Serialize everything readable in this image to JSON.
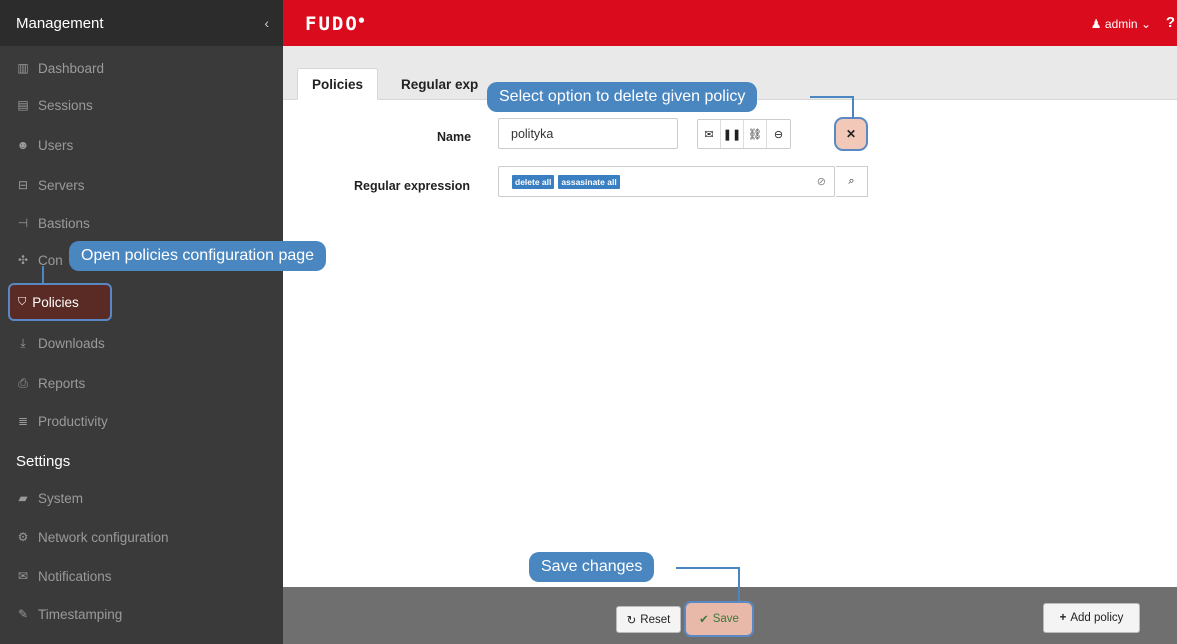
{
  "sidebar": {
    "header": "Management",
    "collapse_icon": "‹",
    "items": [
      {
        "label": "Dashboard",
        "icon": "dashboard-icon"
      },
      {
        "label": "Sessions",
        "icon": "film-icon"
      },
      {
        "label": "Users",
        "icon": "users-icon"
      },
      {
        "label": "Servers",
        "icon": "server-icon"
      },
      {
        "label": "Bastions",
        "icon": "sitemap-icon"
      },
      {
        "label": "Con",
        "icon": "arrows-icon"
      },
      {
        "label": "Policies",
        "icon": "shield-icon"
      },
      {
        "label": "Downloads",
        "icon": "download-icon"
      },
      {
        "label": "Reports",
        "icon": "print-icon"
      },
      {
        "label": "Productivity",
        "icon": "list-icon"
      }
    ],
    "settings_header": "Settings",
    "settings_items": [
      {
        "label": "System",
        "icon": "folder-icon"
      },
      {
        "label": "Network configuration",
        "icon": "cogs-icon"
      },
      {
        "label": "Notifications",
        "icon": "envelope-icon"
      },
      {
        "label": "Timestamping",
        "icon": "edit-icon"
      }
    ]
  },
  "topbar": {
    "logo": "FUDO",
    "user": "admin",
    "help": "?"
  },
  "tabs": {
    "policies": "Policies",
    "regex": "Regular exp"
  },
  "form": {
    "name_label": "Name",
    "name_value": "polityka",
    "regex_label": "Regular expression",
    "tags": [
      "delete all",
      "assasinate all"
    ]
  },
  "footer": {
    "reset_label": "Reset",
    "save_label": "Save",
    "add_label": "Add policy"
  },
  "callouts": {
    "delete": "Select option to delete given policy",
    "open": "Open policies configuration page",
    "save": "Save changes"
  },
  "colors": {
    "topbar": "#d90b1d",
    "sidebar": "#3a3a3a",
    "callout": "#4a86c0",
    "tag": "#3a7fc1"
  }
}
